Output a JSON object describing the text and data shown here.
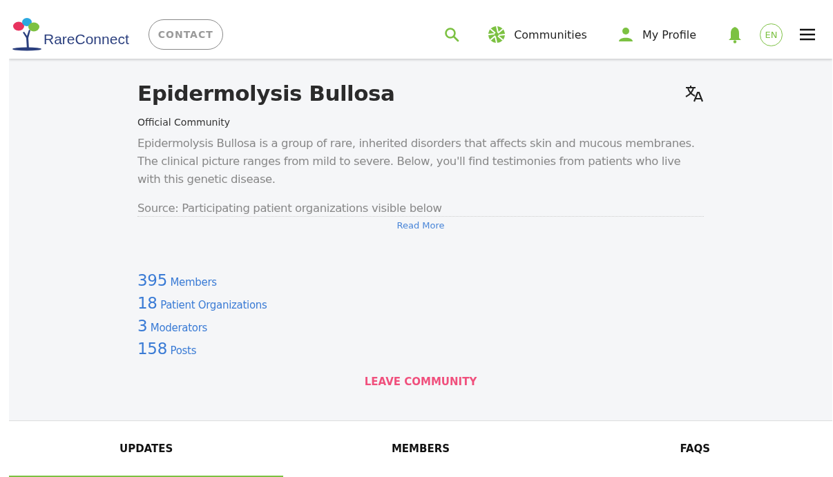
{
  "header": {
    "logo_text": "RareConnect",
    "contact": "CONTACT",
    "nav": [
      {
        "kind": "search"
      },
      {
        "kind": "communities",
        "label": "Communities"
      },
      {
        "kind": "profile",
        "label": "My Profile"
      },
      {
        "kind": "bell"
      }
    ],
    "language": "EN"
  },
  "community": {
    "title": "Epidermolysis Bullosa",
    "subtitle": "Official Community",
    "description": "Epidermolysis Bullosa is a group of rare, inherited disorders that affects skin and mucous membranes. The clinical picture ranges from mild to severe. Below, you'll find testimonies from patients who live with this genetic disease.",
    "source": "Source: Participating patient organizations visible below",
    "read_more": "Read More",
    "stats": [
      {
        "count": "395",
        "label": "Members"
      },
      {
        "count": "18",
        "label": "Patient Organizations"
      },
      {
        "count": "3",
        "label": "Moderators"
      },
      {
        "count": "158",
        "label": "Posts"
      }
    ],
    "leave": "LEAVE COMMUNITY"
  },
  "tabs": [
    {
      "label": "UPDATES",
      "selected": true
    },
    {
      "label": "MEMBERS",
      "selected": false
    },
    {
      "label": "FAQS",
      "selected": false
    }
  ]
}
